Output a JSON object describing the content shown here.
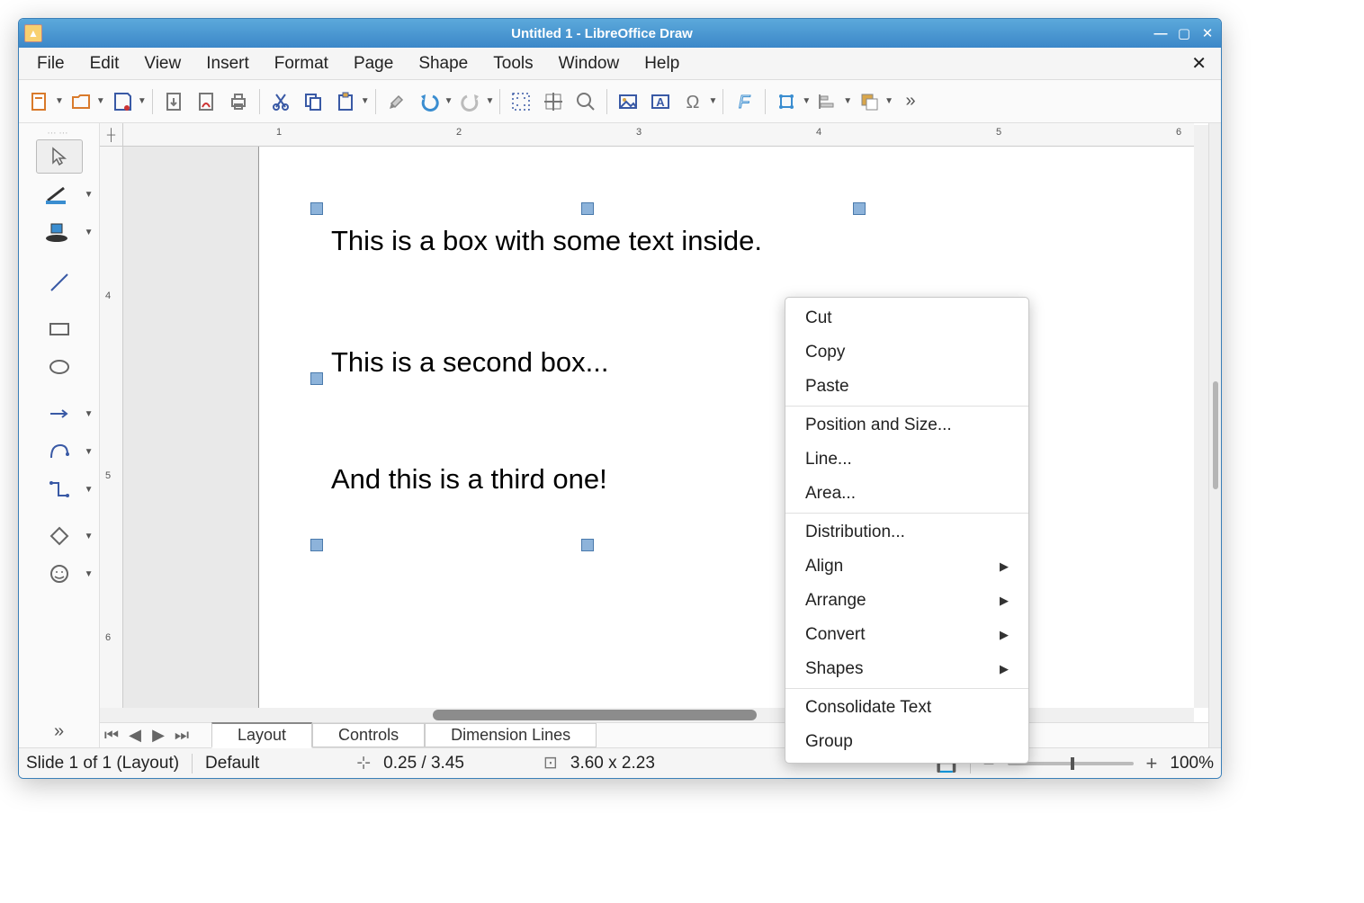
{
  "titlebar": {
    "title": "Untitled 1 - LibreOffice Draw"
  },
  "menubar": {
    "items": [
      "File",
      "Edit",
      "View",
      "Insert",
      "Format",
      "Page",
      "Shape",
      "Tools",
      "Window",
      "Help"
    ]
  },
  "toolbar": {
    "icons": [
      "new-doc",
      "open",
      "save",
      "sep",
      "export",
      "export-pdf",
      "print",
      "sep",
      "cut",
      "copy",
      "paste",
      "sep",
      "clone-format",
      "undo",
      "redo",
      "sep",
      "grid",
      "snap",
      "zoom",
      "sep",
      "image",
      "textbox",
      "special-char",
      "sep",
      "fontwork",
      "sep",
      "transform",
      "align",
      "arrange",
      "more"
    ]
  },
  "side_toolbar": {
    "tools": [
      "dots",
      "select",
      "line-color",
      "fill-color",
      "line",
      "rectangle",
      "ellipse",
      "arrow",
      "curve",
      "connector",
      "basic-shapes",
      "symbol"
    ]
  },
  "rulers": {
    "h_labels": [
      "1",
      "2",
      "3",
      "4",
      "5",
      "6"
    ],
    "v_labels": [
      "4",
      "5",
      "6"
    ]
  },
  "canvas": {
    "text1": "This is a box with some text inside.",
    "text2": "This is a second box...",
    "text3": "And this is a third one!"
  },
  "tabs": {
    "items": [
      "Layout",
      "Controls",
      "Dimension Lines"
    ],
    "active": 0
  },
  "statusbar": {
    "slide": "Slide 1 of 1 (Layout)",
    "style": "Default",
    "pos": "0.25 / 3.45",
    "size": "3.60 x 2.23",
    "zoom": "100%"
  },
  "context_menu": {
    "items": [
      {
        "label": "Cut",
        "type": "item"
      },
      {
        "label": "Copy",
        "type": "item"
      },
      {
        "label": "Paste",
        "type": "item"
      },
      {
        "type": "sep"
      },
      {
        "label": "Position and Size...",
        "type": "item"
      },
      {
        "label": "Line...",
        "type": "item"
      },
      {
        "label": "Area...",
        "type": "item"
      },
      {
        "type": "sep"
      },
      {
        "label": "Distribution...",
        "type": "item"
      },
      {
        "label": "Align",
        "type": "sub"
      },
      {
        "label": "Arrange",
        "type": "sub"
      },
      {
        "label": "Convert",
        "type": "sub"
      },
      {
        "label": "Shapes",
        "type": "sub"
      },
      {
        "type": "sep"
      },
      {
        "label": "Consolidate Text",
        "type": "item"
      },
      {
        "label": "Group",
        "type": "item"
      }
    ]
  }
}
